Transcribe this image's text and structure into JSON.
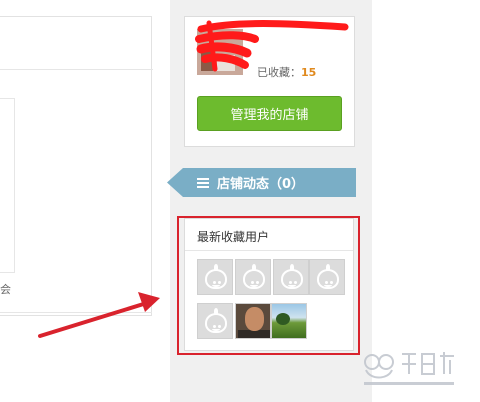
{
  "profile": {
    "favorites_label": "已收藏：",
    "favorites_count": "15",
    "manage_button": "管理我的店铺"
  },
  "shop_news": {
    "label": "店铺动态（0）",
    "icon": "list-icon"
  },
  "latest_fav_users": {
    "title": "最新收藏用户",
    "users": [
      {
        "type": "default-avatar"
      },
      {
        "type": "default-avatar"
      },
      {
        "type": "default-avatar"
      },
      {
        "type": "default-avatar"
      },
      {
        "type": "default-avatar"
      },
      {
        "type": "photo-man"
      },
      {
        "type": "photo-grass"
      }
    ]
  },
  "left_panel": {
    "partial_text": "会"
  },
  "colors": {
    "manage_button_bg": "#6dbb2e",
    "news_tab_bg": "#7aaec6",
    "favorites_count": "#e08a1e",
    "annotation_red": "#d9232d"
  }
}
